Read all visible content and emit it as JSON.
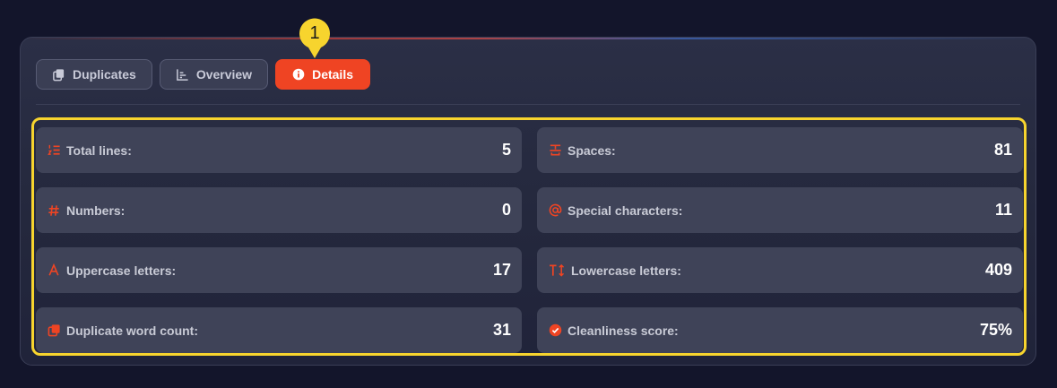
{
  "tabs": [
    {
      "label": "Duplicates",
      "icon": "copy-icon",
      "active": false
    },
    {
      "label": "Overview",
      "icon": "bar-chart-icon",
      "active": false
    },
    {
      "label": "Details",
      "icon": "info-icon",
      "active": true
    }
  ],
  "callout": {
    "number": "1",
    "color": "#f7d42e"
  },
  "stats": [
    {
      "label": "Total lines:",
      "value": "5",
      "icon": "list-ordered-icon"
    },
    {
      "label": "Spaces:",
      "value": "81",
      "icon": "space-icon"
    },
    {
      "label": "Numbers:",
      "value": "0",
      "icon": "hash-icon"
    },
    {
      "label": "Special characters:",
      "value": "11",
      "icon": "at-sign-icon"
    },
    {
      "label": "Uppercase letters:",
      "value": "17",
      "icon": "uppercase-icon"
    },
    {
      "label": "Lowercase letters:",
      "value": "409",
      "icon": "text-case-icon"
    },
    {
      "label": "Duplicate word count:",
      "value": "31",
      "icon": "copy-icon"
    },
    {
      "label": "Cleanliness score:",
      "value": "75%",
      "icon": "check-badge-icon"
    }
  ],
  "colors": {
    "accent": "#ef4423",
    "highlight": "#f7d42e",
    "background": "#13152b"
  }
}
